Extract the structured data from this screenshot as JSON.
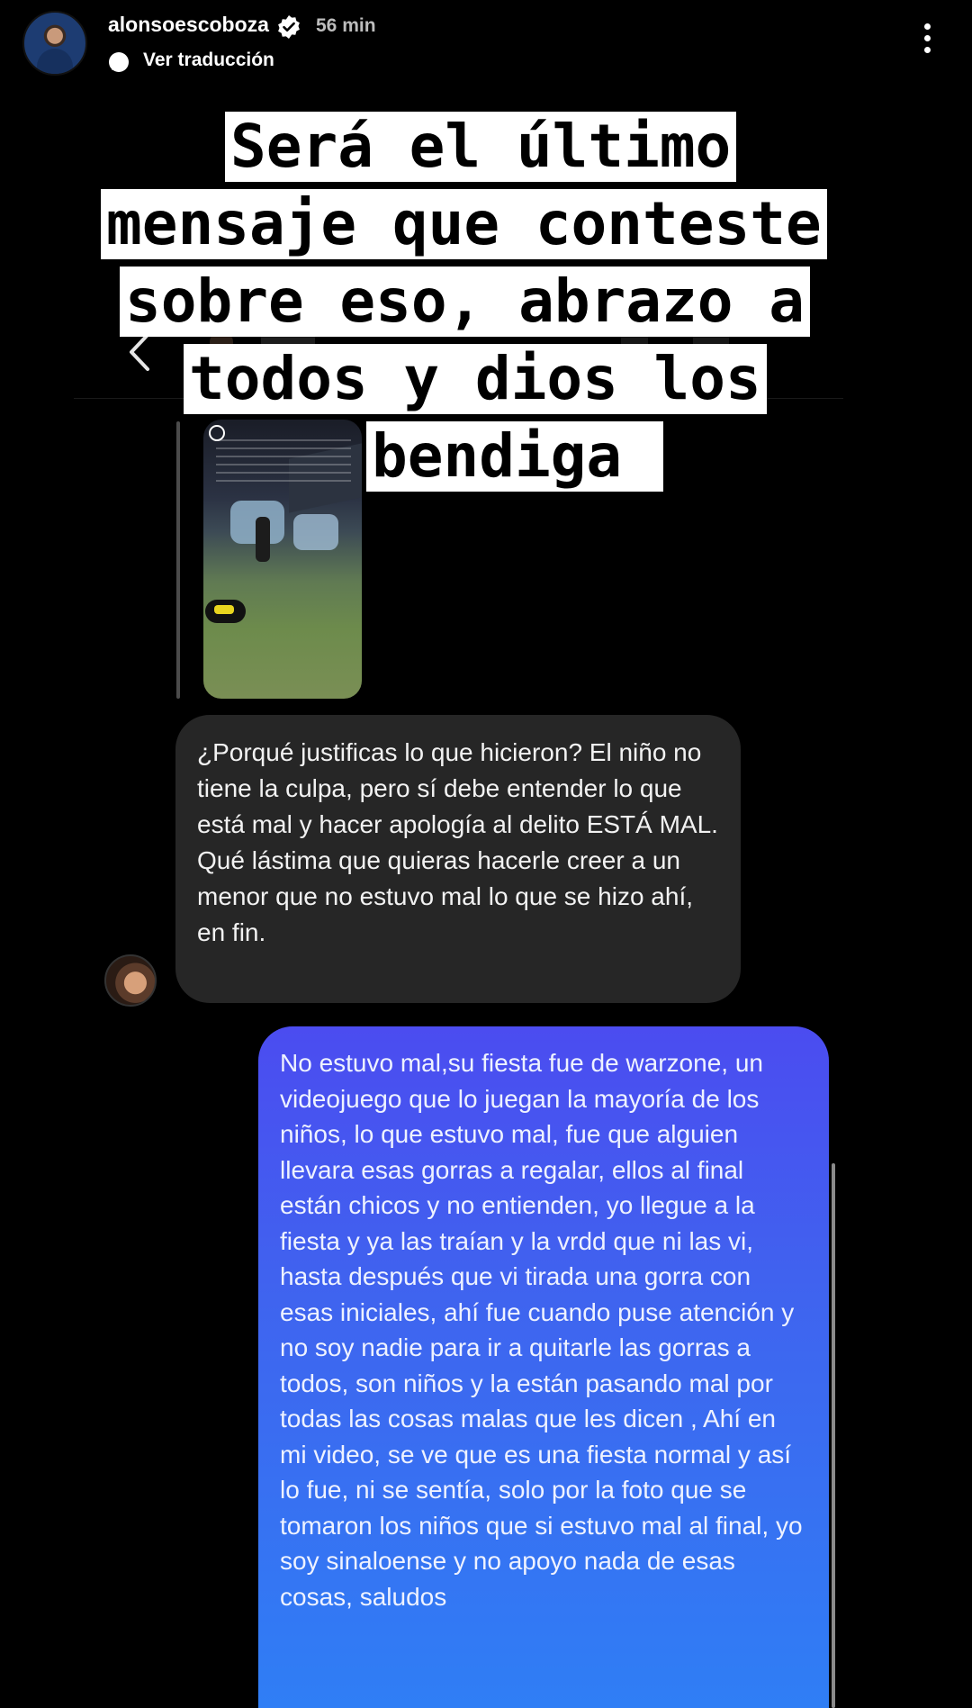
{
  "header": {
    "username": "alonsoescoboza",
    "time": "56 min",
    "translate_label": "Ver traducción"
  },
  "caption": {
    "lines": [
      "Será el último",
      "mensaje que conteste",
      "sobre eso, abrazo a",
      "todos y dios los",
      "bendiga "
    ]
  },
  "chat": {
    "incoming": {
      "paragraph1": "¿Porqué justificas lo que hicieron? El niño no tiene la culpa, pero sí debe entender lo que está mal y hacer apología al delito ESTÁ MAL.",
      "paragraph2": "Qué lástima que quieras hacerle creer a un menor que no estuvo mal lo que se hizo ahí, en fin."
    },
    "outgoing": {
      "text": "No estuvo mal,su fiesta fue de warzone, un videojuego que lo juegan la mayoría de los niños, lo que estuvo mal, fue que alguien llevara esas gorras a regalar, ellos al final están chicos y no entienden, yo llegue a la fiesta y ya las traían y la vrdd que ni las vi, hasta después que vi tirada una gorra con esas iniciales, ahí fue cuando puse atención y no soy nadie para ir a quitarle las gorras a todos, son niños y la están pasando mal por todas las cosas malas que les dicen , Ahí en mi video, se ve que es una fiesta normal y así lo fue, ni se sentía, solo por la foto que se tomaron los niños que si estuvo mal al final, yo soy sinaloense y no apoyo nada de esas cosas, saludos"
    }
  },
  "colors": {
    "background": "#000000",
    "incoming_bubble": "#262626",
    "outgoing_bubble_top": "#4b4cf0",
    "outgoing_bubble_bottom": "#2f7ef5",
    "caption_bg": "#ffffff"
  }
}
